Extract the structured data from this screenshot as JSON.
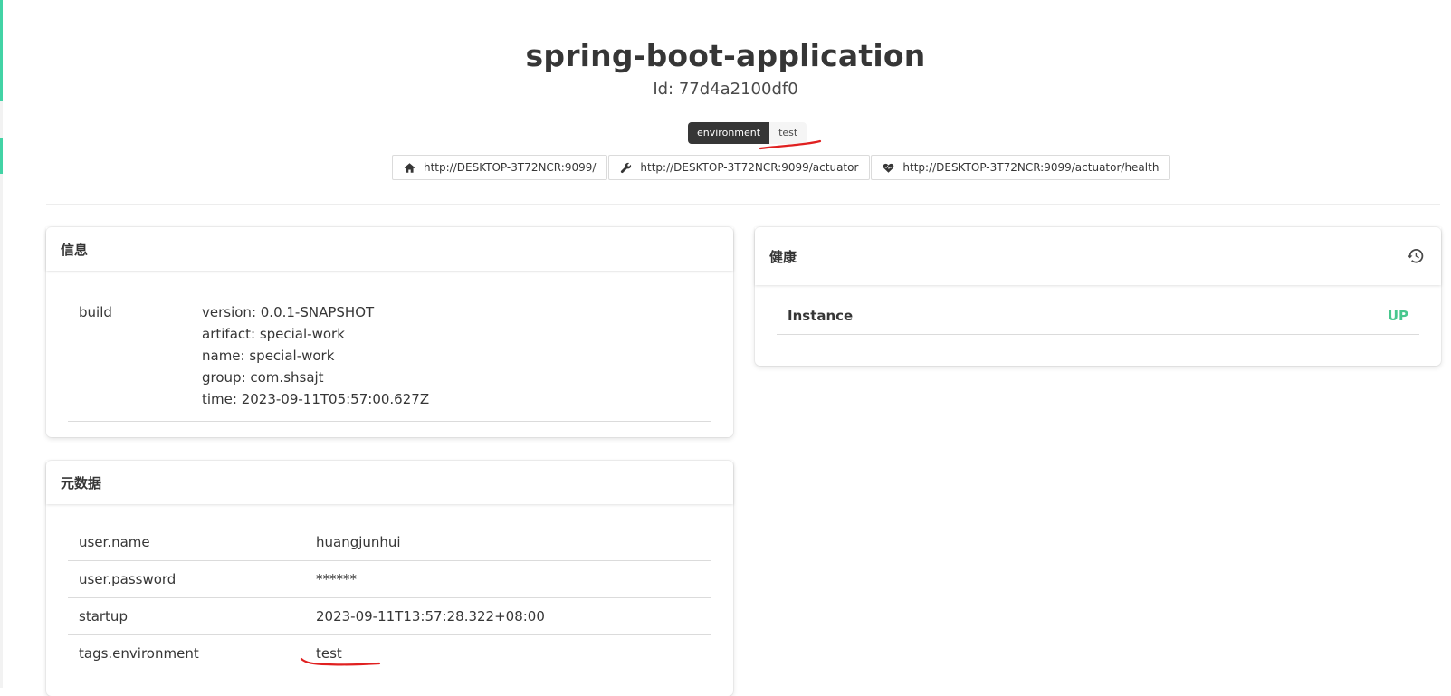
{
  "app": {
    "name": "spring-boot-application",
    "id": "Id: 77d4a2100df0"
  },
  "tags": [
    {
      "key": "environment",
      "value": "test"
    }
  ],
  "links": [
    {
      "icon": "home-icon",
      "label": "http://DESKTOP-3T72NCR:9099/"
    },
    {
      "icon": "wrench-icon",
      "label": "http://DESKTOP-3T72NCR:9099/actuator"
    },
    {
      "icon": "heartbeat-icon",
      "label": "http://DESKTOP-3T72NCR:9099/actuator/health"
    }
  ],
  "info": {
    "title": "信息",
    "rows": [
      {
        "key": "build",
        "values": [
          "version: 0.0.1-SNAPSHOT",
          "artifact: special-work",
          "name: special-work",
          "group: com.shsajt",
          "time: 2023-09-11T05:57:00.627Z"
        ]
      }
    ]
  },
  "metadata": {
    "title": "元数据",
    "rows": [
      {
        "key": "user.name",
        "value": "huangjunhui"
      },
      {
        "key": "user.password",
        "value": "******"
      },
      {
        "key": "startup",
        "value": "2023-09-11T13:57:28.322+08:00"
      },
      {
        "key": "tags.environment",
        "value": "test"
      }
    ]
  },
  "health": {
    "title": "健康",
    "history_icon": "history-icon",
    "rows": [
      {
        "name": "Instance",
        "status": "UP"
      }
    ]
  },
  "colors": {
    "accent": "#42d3a5",
    "status_up": "#48c78e",
    "annotation": "#e02020"
  }
}
